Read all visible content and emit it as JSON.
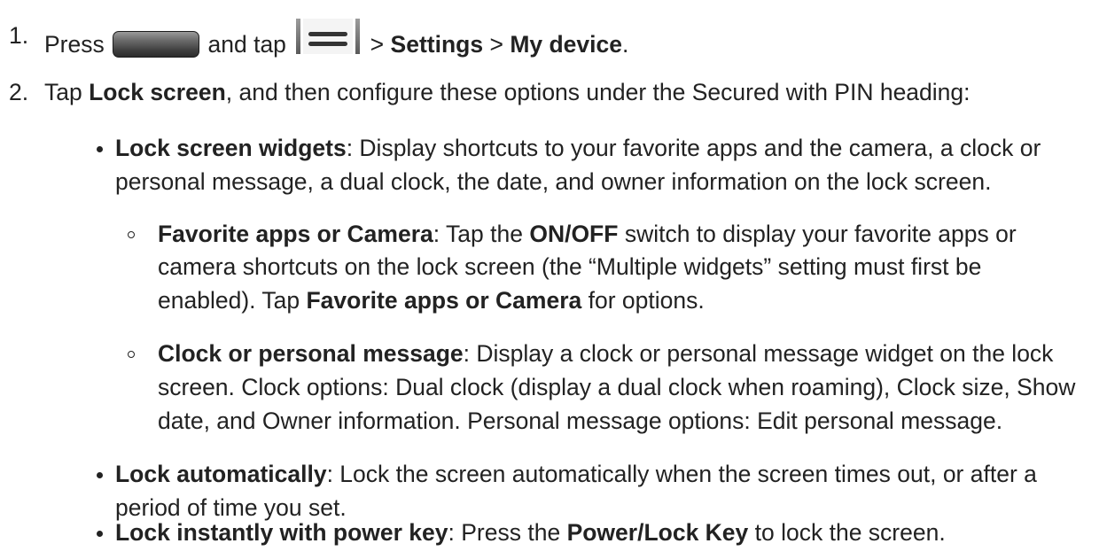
{
  "steps": [
    {
      "number": "1.",
      "text_press": "Press",
      "home_key_icon": "home-key-icon",
      "text_and_tap": "and tap",
      "menu_key_icon": "menu-key-icon",
      "sep1": ">",
      "settings": "Settings",
      "sep2": ">",
      "my_device": "My device",
      "end": "."
    },
    {
      "number": "2.",
      "text_tap": "Tap",
      "lock_screen": "Lock screen",
      "rest": ", and then configure these options under the Secured with PIN heading:"
    }
  ],
  "bullets": {
    "lock_screen_widgets": {
      "term": "Lock screen widgets",
      "line1": ": Display shortcuts to your favorite apps and the camera, a clock or",
      "line2": "personal message, a dual clock, the date, and owner information on the lock screen."
    },
    "favorite_apps": {
      "term": "Favorite apps or Camera",
      "line1_a": ": Tap the",
      "line1_b": "ON/OFF",
      "line1_c": "switch to display your favorite apps or",
      "line2": "camera shortcuts on the lock screen (the “Multiple widgets” setting must first be",
      "line3_a": "enabled). Tap",
      "line3_b": "Favorite apps or Camera",
      "line3_c": "for options."
    },
    "clock_message": {
      "term": "Clock or personal message",
      "line1": ": Display a clock or personal message widget on the lock",
      "line2": "screen. Clock options: Dual clock (display a dual clock when roaming), Clock size, Show",
      "line3": "date, and Owner information. Personal message options: Edit personal message."
    },
    "lock_automatically": {
      "term": "Lock automatically",
      "line1": ": Lock the screen automatically when the screen times out, or after a",
      "line2": "period of time you set."
    },
    "lock_instantly": {
      "term": "Lock instantly with power key",
      "line1_a": ": Press the",
      "line1_b": "Power/Lock Key",
      "line1_c": "to lock the screen."
    }
  }
}
